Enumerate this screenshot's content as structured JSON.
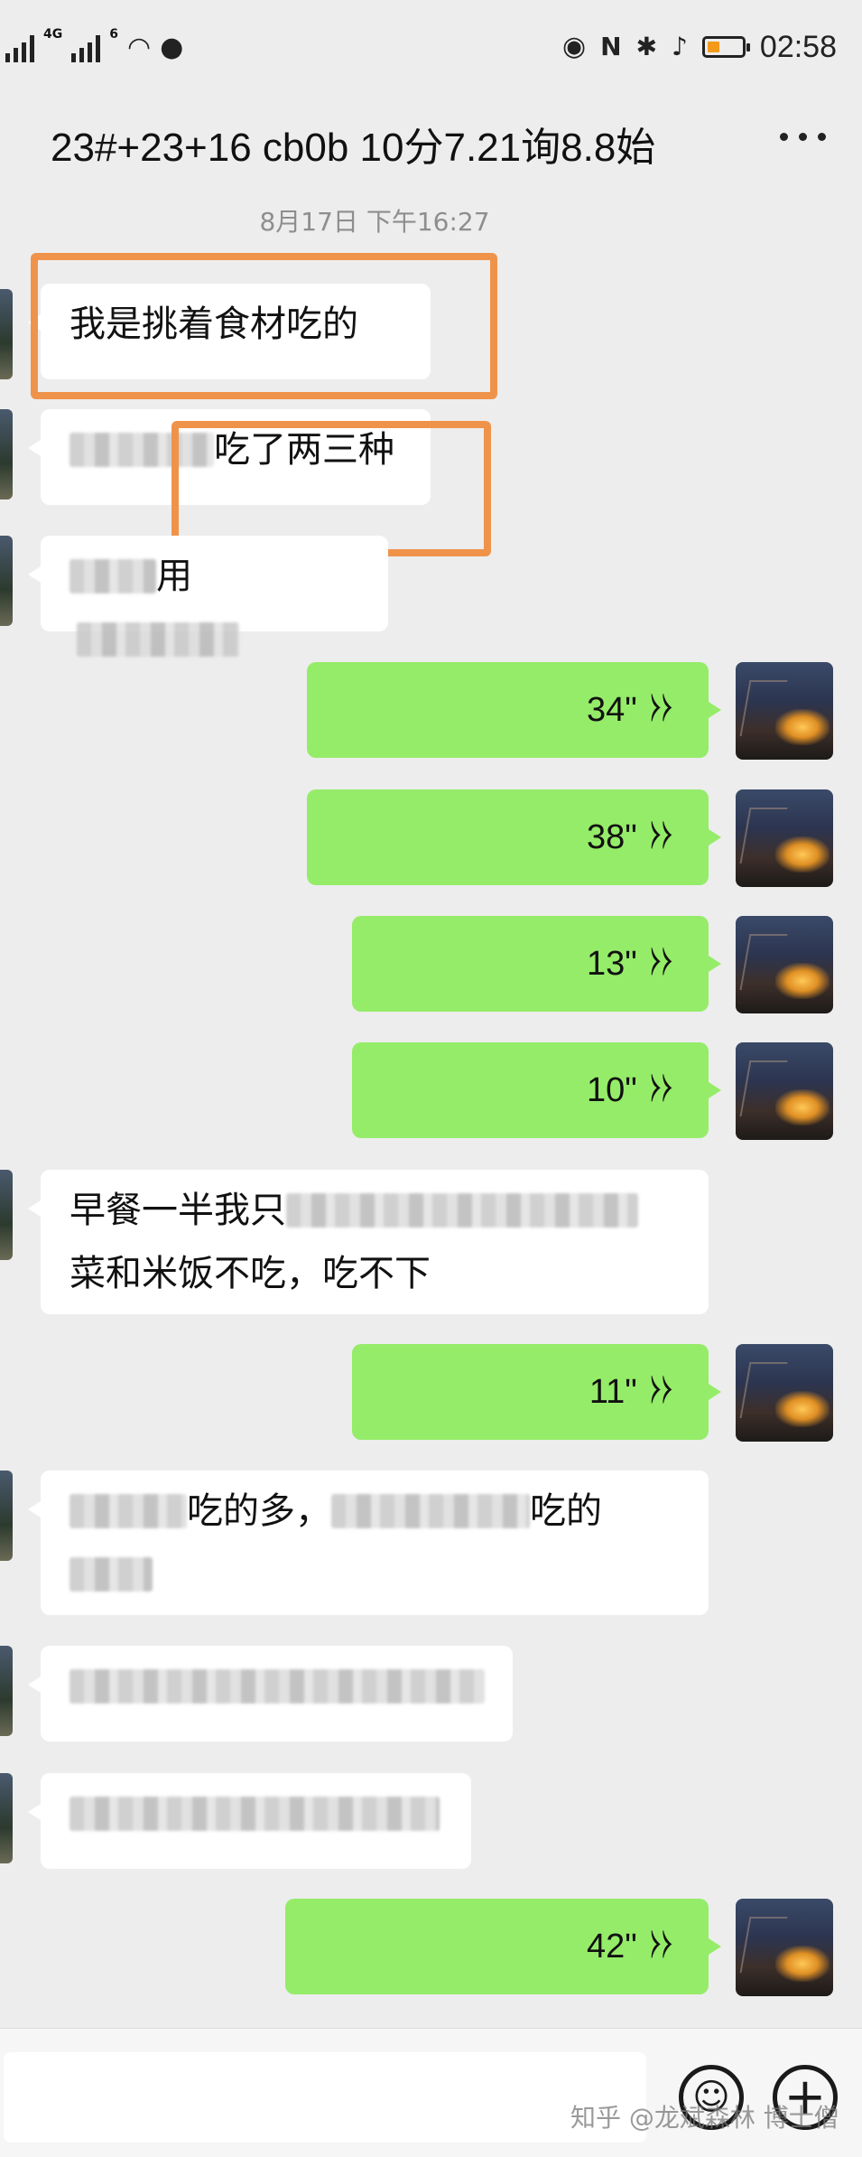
{
  "status_bar": {
    "network_label": "4G",
    "network2_label": "6",
    "time": "02:58",
    "battery_level": 0.35,
    "icons": [
      "signal-icon",
      "wifi-icon",
      "wechat-icon",
      "eye-icon",
      "nfc-icon",
      "bluetooth-icon",
      "mute-icon",
      "battery-icon"
    ]
  },
  "header": {
    "title": "23#+23+16 cb0b 10分7.21询8.8始",
    "more_icon": "more-dots-icon"
  },
  "timestamp": "8月17日 下午16:27",
  "messages": [
    {
      "from": "other",
      "type": "text",
      "text": "我是挑着食材吃的"
    },
    {
      "from": "other",
      "type": "text",
      "visible_text": "吃了两三种"
    },
    {
      "from": "other",
      "type": "text",
      "visible_text": "用"
    },
    {
      "from": "me",
      "type": "voice",
      "duration": "34\""
    },
    {
      "from": "me",
      "type": "voice",
      "duration": "38\""
    },
    {
      "from": "me",
      "type": "voice",
      "duration": "13\""
    },
    {
      "from": "me",
      "type": "voice",
      "duration": "10\""
    },
    {
      "from": "other",
      "type": "text",
      "visible_text_1": "早餐一半我只",
      "visible_text_2": "菜和米饭不吃，吃不下"
    },
    {
      "from": "me",
      "type": "voice",
      "duration": "11\""
    },
    {
      "from": "other",
      "type": "text",
      "visible_text_1": "吃的多，",
      "visible_text_2": "吃的"
    },
    {
      "from": "other",
      "type": "text",
      "visible_text": ""
    },
    {
      "from": "other",
      "type": "text",
      "visible_text": ""
    },
    {
      "from": "me",
      "type": "voice",
      "duration": "42\""
    }
  ],
  "input_bar": {
    "emoji_icon": "emoji-icon",
    "plus_icon": "plus-icon"
  },
  "watermark": "知乎 @龙斌森林 博士僧",
  "colors": {
    "background": "#ededed",
    "incoming_bubble": "#ffffff",
    "outgoing_bubble": "#95ec69",
    "highlight_box": "#f0934a"
  }
}
